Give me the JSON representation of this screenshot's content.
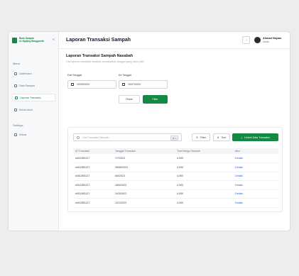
{
  "sidebar": {
    "brand_line1": "Bank Sampah",
    "brand_line2": "Ar-Ngajing Banggareth",
    "menu_label": "Menu",
    "settings_label": "Settings",
    "items": [
      {
        "label": "Dashboard",
        "active": false
      },
      {
        "label": "Data Sampah",
        "active": false
      },
      {
        "label": "Laporan Transaksi",
        "active": true
      },
      {
        "label": "Kelola Akun",
        "active": false
      }
    ],
    "logout_label": "Keluar"
  },
  "header": {
    "title": "Laporan Transaksi Sampah",
    "user_name": "Ahmad Hayam",
    "user_role": "Admin"
  },
  "filters": {
    "title": "Laporan Transaksi Sampah Nasabah",
    "subtitle": "Cari laporan transaksi nasabah berdasarkan tanggal yang kamu pilih",
    "from_label": "Dari Tanggal",
    "from_value": "10/09/2023",
    "to_label": "Ke Tanggal",
    "to_value": "15/07/2023",
    "reset_label": "Reset",
    "filter_label": "Filter"
  },
  "table_tools": {
    "search_placeholder": "Cari Transaksi Sampah",
    "shortcut": "⌘ K",
    "filter_label": "Filter",
    "sort_label": "Sort",
    "download_label": "Unduh Data Transaksi"
  },
  "table": {
    "columns": [
      "ID Transaksi",
      "Tanggal Transaksi",
      "Total Harga Sampah",
      "Aksi"
    ],
    "rows": [
      {
        "id": "#4512B3127",
        "date": "7/7/2023",
        "total": "4.000",
        "action": "Details"
      },
      {
        "id": "#4512B3127",
        "date": "26/06/2023",
        "total": "4.000",
        "action": "Details"
      },
      {
        "id": "#4512B3127",
        "date": "6/6/2023",
        "total": "4.000",
        "action": "Details"
      },
      {
        "id": "#4512B3127",
        "date": "16/5/2023",
        "total": "4.000",
        "action": "Details"
      },
      {
        "id": "#4512B3127",
        "date": "24/3/2023",
        "total": "4.000",
        "action": "Details"
      },
      {
        "id": "#4512B3127",
        "date": "12/1/2023",
        "total": "4.000",
        "action": "Details"
      }
    ]
  },
  "colors": {
    "accent": "#138a43",
    "link": "#2563eb"
  }
}
